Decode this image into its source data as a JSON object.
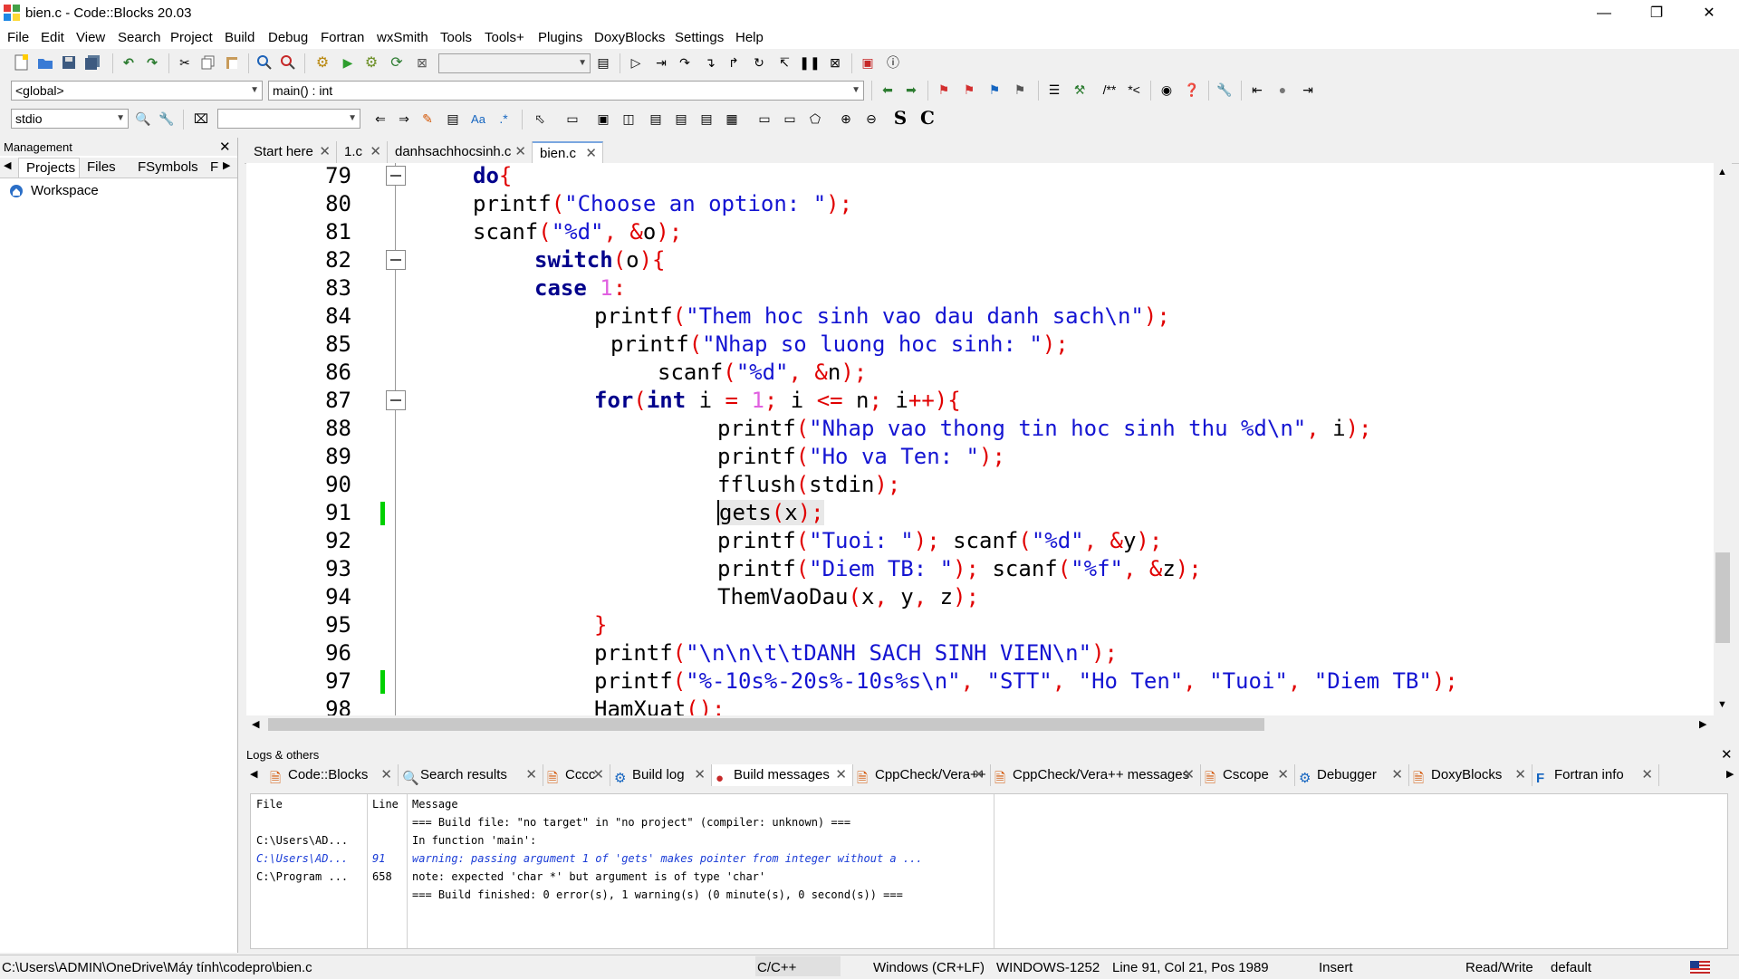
{
  "window": {
    "title": "bien.c - Code::Blocks 20.03"
  },
  "menu": [
    "File",
    "Edit",
    "View",
    "Search",
    "Project",
    "Build",
    "Debug",
    "Fortran",
    "wxSmith",
    "Tools",
    "Tools+",
    "Plugins",
    "DoxyBlocks",
    "Settings",
    "Help"
  ],
  "toolbar2": {
    "scope": "<global>",
    "function": "main() : int"
  },
  "toolbar3": {
    "header": "stdio",
    "search": ""
  },
  "management": {
    "title": "Management",
    "tabs": [
      "Projects",
      "Files",
      "FSymbols",
      "F"
    ],
    "workspace": "Workspace"
  },
  "editor_tabs": [
    "Start here",
    "1.c",
    "danhsachhocsinh.c",
    "bien.c"
  ],
  "line_numbers": [
    "79",
    "80",
    "81",
    "82",
    "83",
    "84",
    "85",
    "86",
    "87",
    "88",
    "89",
    "90",
    "91",
    "92",
    "93",
    "94",
    "95",
    "96",
    "97",
    "98"
  ],
  "code_lines": [
    "do{",
    "printf(\"Choose an option: \");",
    "scanf(\"%d\", &o);",
    "switch(o){",
    "case 1:",
    "printf(\"Them hoc sinh vao dau danh sach\\n\");",
    "printf(\"Nhap so luong hoc sinh: \");",
    "scanf(\"%d\", &n);",
    "for(int i = 1; i <= n; i++){",
    "printf(\"Nhap vao thong tin hoc sinh thu %d\\n\", i);",
    "printf(\"Ho va Ten: \");",
    "fflush(stdin);",
    "gets(x);",
    "printf(\"Tuoi: \"); scanf(\"%d\", &y);",
    "printf(\"Diem TB: \"); scanf(\"%f\", &z);",
    "ThemVaoDau(x, y, z);",
    "}",
    "printf(\"\\n\\n\\t\\tDANH SACH SINH VIEN\\n\");",
    "printf(\"%-10s%-20s%-10s%s\\n\", \"STT\", \"Ho Ten\", \"Tuoi\", \"Diem TB\");",
    "HamXuat();"
  ],
  "logs": {
    "title": "Logs & others",
    "tabs": [
      "Code::Blocks",
      "Search results",
      "Cccc",
      "Build log",
      "Build messages",
      "CppCheck/Vera++",
      "CppCheck/Vera++ messages",
      "Cscope",
      "Debugger",
      "DoxyBlocks",
      "Fortran info"
    ],
    "columns": [
      "File",
      "Line",
      "Message"
    ],
    "rows": [
      {
        "file": "",
        "line": "",
        "message": "=== Build file: \"no target\" in \"no project\" (compiler: unknown) ==="
      },
      {
        "file": "C:\\Users\\AD...",
        "line": "",
        "message": "In function 'main':"
      },
      {
        "file": "C:\\Users\\AD...",
        "line": "91",
        "message": "warning: passing argument 1 of 'gets' makes pointer from integer without a ..."
      },
      {
        "file": "C:\\Program ...",
        "line": "658",
        "message": "note: expected 'char *' but argument is of type 'char'"
      },
      {
        "file": "",
        "line": "",
        "message": "=== Build finished: 0 error(s), 1 warning(s) (0 minute(s), 0 second(s)) ==="
      }
    ]
  },
  "status": {
    "path": "C:\\Users\\ADMIN\\OneDrive\\Máy tính\\codepro\\bien.c",
    "language": "C/C++",
    "eol": "Windows (CR+LF)",
    "encoding": "WINDOWS-1252",
    "position": "Line 91, Col 21, Pos 1989",
    "mode": "Insert",
    "access": "Read/Write",
    "profile": "default"
  },
  "colors": {
    "keyword": "#00008b",
    "string": "#1414d2",
    "operator": "#e00000",
    "number": "#e060e0",
    "changebar": "#00d000"
  }
}
